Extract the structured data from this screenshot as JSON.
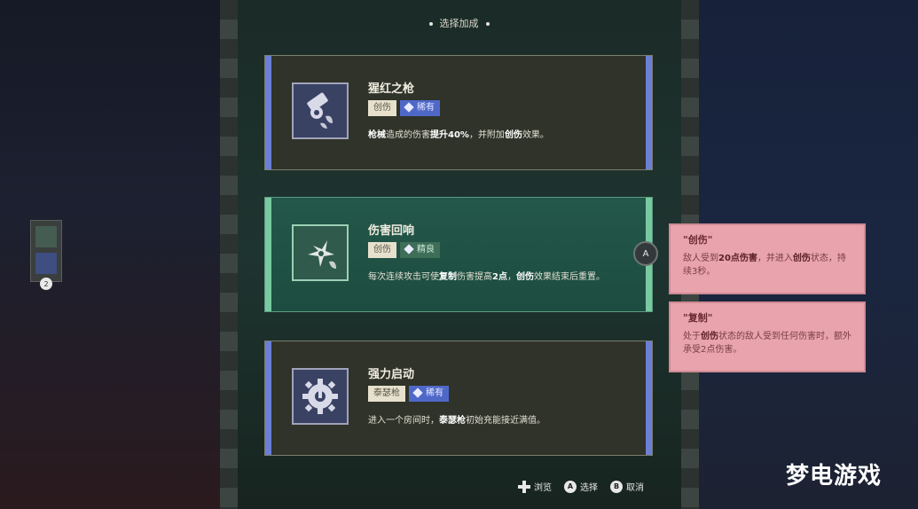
{
  "header": {
    "title": "选择加成"
  },
  "cards": [
    {
      "title": "猩红之枪",
      "tags": [
        {
          "label": "创伤",
          "style": "plain"
        },
        {
          "label": "稀有",
          "style": "rare"
        }
      ],
      "desc_parts": [
        "枪械",
        "造成的伤害",
        "提升40%",
        "，并附加",
        "创伤",
        "效果。"
      ],
      "icon": "gun-icon",
      "selected": false
    },
    {
      "title": "伤害回响",
      "tags": [
        {
          "label": "创伤",
          "style": "plain"
        },
        {
          "label": "精良",
          "style": "fine"
        }
      ],
      "desc_parts": [
        "每次连续攻击可使",
        "复制",
        "伤害提高",
        "2点",
        "，",
        "创伤",
        "效果结束后重置。"
      ],
      "icon": "shuriken-icon",
      "selected": true
    },
    {
      "title": "强力启动",
      "tags": [
        {
          "label": "泰瑟枪",
          "style": "plain"
        },
        {
          "label": "稀有",
          "style": "rare"
        }
      ],
      "desc_parts": [
        "进入一个房间时，",
        "泰瑟枪",
        "初始充能接近满值。"
      ],
      "icon": "gear-power-icon",
      "selected": false
    }
  ],
  "tooltips": [
    {
      "title": "\"创伤\"",
      "body_parts": [
        "敌人受到",
        "20点伤害",
        "，并进入",
        "创伤",
        "状态，持续3秒。"
      ]
    },
    {
      "title": "\"复制\"",
      "body_parts": [
        "处于",
        "创伤",
        "状态的敌人受到任何伤害时，额外承受2点伤害。"
      ]
    }
  ],
  "a_button": "A",
  "side_panel": {
    "count": "2"
  },
  "footer": {
    "browse": "浏览",
    "select_key": "A",
    "select": "选择",
    "cancel_key": "B",
    "cancel": "取消"
  },
  "watermark": "梦电游戏",
  "colors": {
    "rare": "#4f68c8",
    "fine": "#3e6e58",
    "selected_card": "#23584a",
    "tooltip": "#e8a3ac"
  }
}
